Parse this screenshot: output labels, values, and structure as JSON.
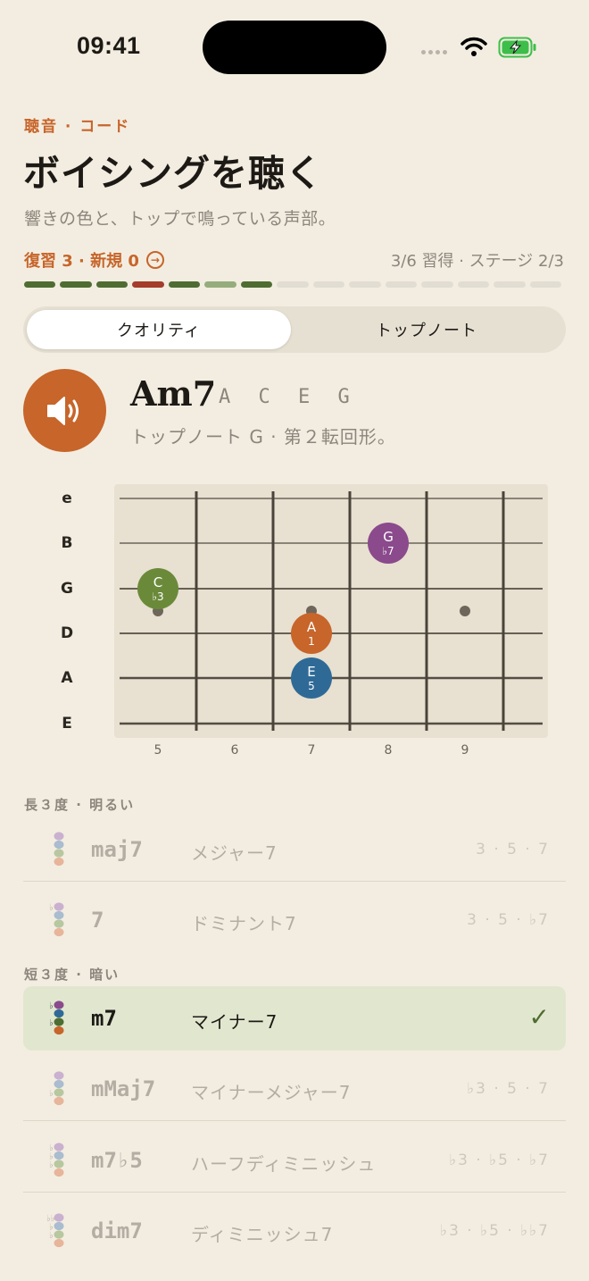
{
  "status": {
    "time": "09:41"
  },
  "header": {
    "overline": "聴音 · コード",
    "title": "ボイシングを聴く",
    "subtitle": "響きの色と、トップで鳴っている声部。",
    "review_label": "復習 3 · 新規 0",
    "progress_text": "3/6 習得 · ステージ 2/3",
    "progress_segments": [
      "#4f6d32",
      "#4f6d32",
      "#4f6d32",
      "#a43d2a",
      "#4f6d32",
      "#95ad7c",
      "#4f6d32",
      "#e2ddd3",
      "#e2ddd3",
      "#e2ddd3",
      "#e2ddd3",
      "#e2ddd3",
      "#e2ddd3",
      "#e2ddd3",
      "#e2ddd3"
    ]
  },
  "tabs": [
    {
      "label": "クオリティ",
      "selected": true
    },
    {
      "label": "トップノート",
      "selected": false
    }
  ],
  "chord": {
    "name": "Am7",
    "notes": "A C E G",
    "description": "トップノート G · 第２転回形。",
    "play_icon": "speaker-icon"
  },
  "fretboard": {
    "strings": [
      "e",
      "B",
      "G",
      "D",
      "A",
      "E"
    ],
    "frets": [
      "5",
      "6",
      "7",
      "8",
      "9"
    ],
    "inlays": [
      5,
      7,
      9
    ],
    "notes": [
      {
        "string": "G",
        "fret": 5,
        "note": "C",
        "interval": "♭3",
        "color": "#6a8a3a"
      },
      {
        "string": "B",
        "fret": 8,
        "note": "G",
        "interval": "♭7",
        "color": "#8a4a8c"
      },
      {
        "string": "D",
        "fret": 7,
        "note": "A",
        "interval": "1",
        "color": "#c7652a"
      },
      {
        "string": "A",
        "fret": 7,
        "note": "E",
        "interval": "5",
        "color": "#2f6a97"
      }
    ]
  },
  "sections": [
    {
      "label": "長３度 · 明るい"
    },
    {
      "label": "短３度 · 暗い"
    }
  ],
  "qualities": [
    {
      "symbol": "maj7",
      "name": "メジャー7",
      "intervals": "3 · 5 · 7",
      "selected": false,
      "icon": "voicing-stack-icon"
    },
    {
      "symbol": "7",
      "name": "ドミナント7",
      "intervals": "3 · 5 · ♭7",
      "selected": false,
      "icon": "voicing-stack-icon"
    },
    {
      "symbol": "m7",
      "name": "マイナー7",
      "intervals": "",
      "selected": true,
      "icon": "voicing-stack-icon"
    },
    {
      "symbol": "mMaj7",
      "name": "マイナーメジャー7",
      "intervals": "♭3 · 5 · 7",
      "selected": false,
      "icon": "voicing-stack-icon"
    },
    {
      "symbol": "m7♭5",
      "name": "ハーフディミニッシュ",
      "intervals": "♭3 · ♭5 · ♭7",
      "selected": false,
      "icon": "voicing-stack-icon"
    },
    {
      "symbol": "dim7",
      "name": "ディミニッシュ7",
      "intervals": "♭3 · ♭5 · ♭♭7",
      "selected": false,
      "icon": "voicing-stack-icon"
    }
  ],
  "colors": {
    "accent": "#c7652a",
    "success": "#4f6d32",
    "background": "#f3ede1"
  }
}
